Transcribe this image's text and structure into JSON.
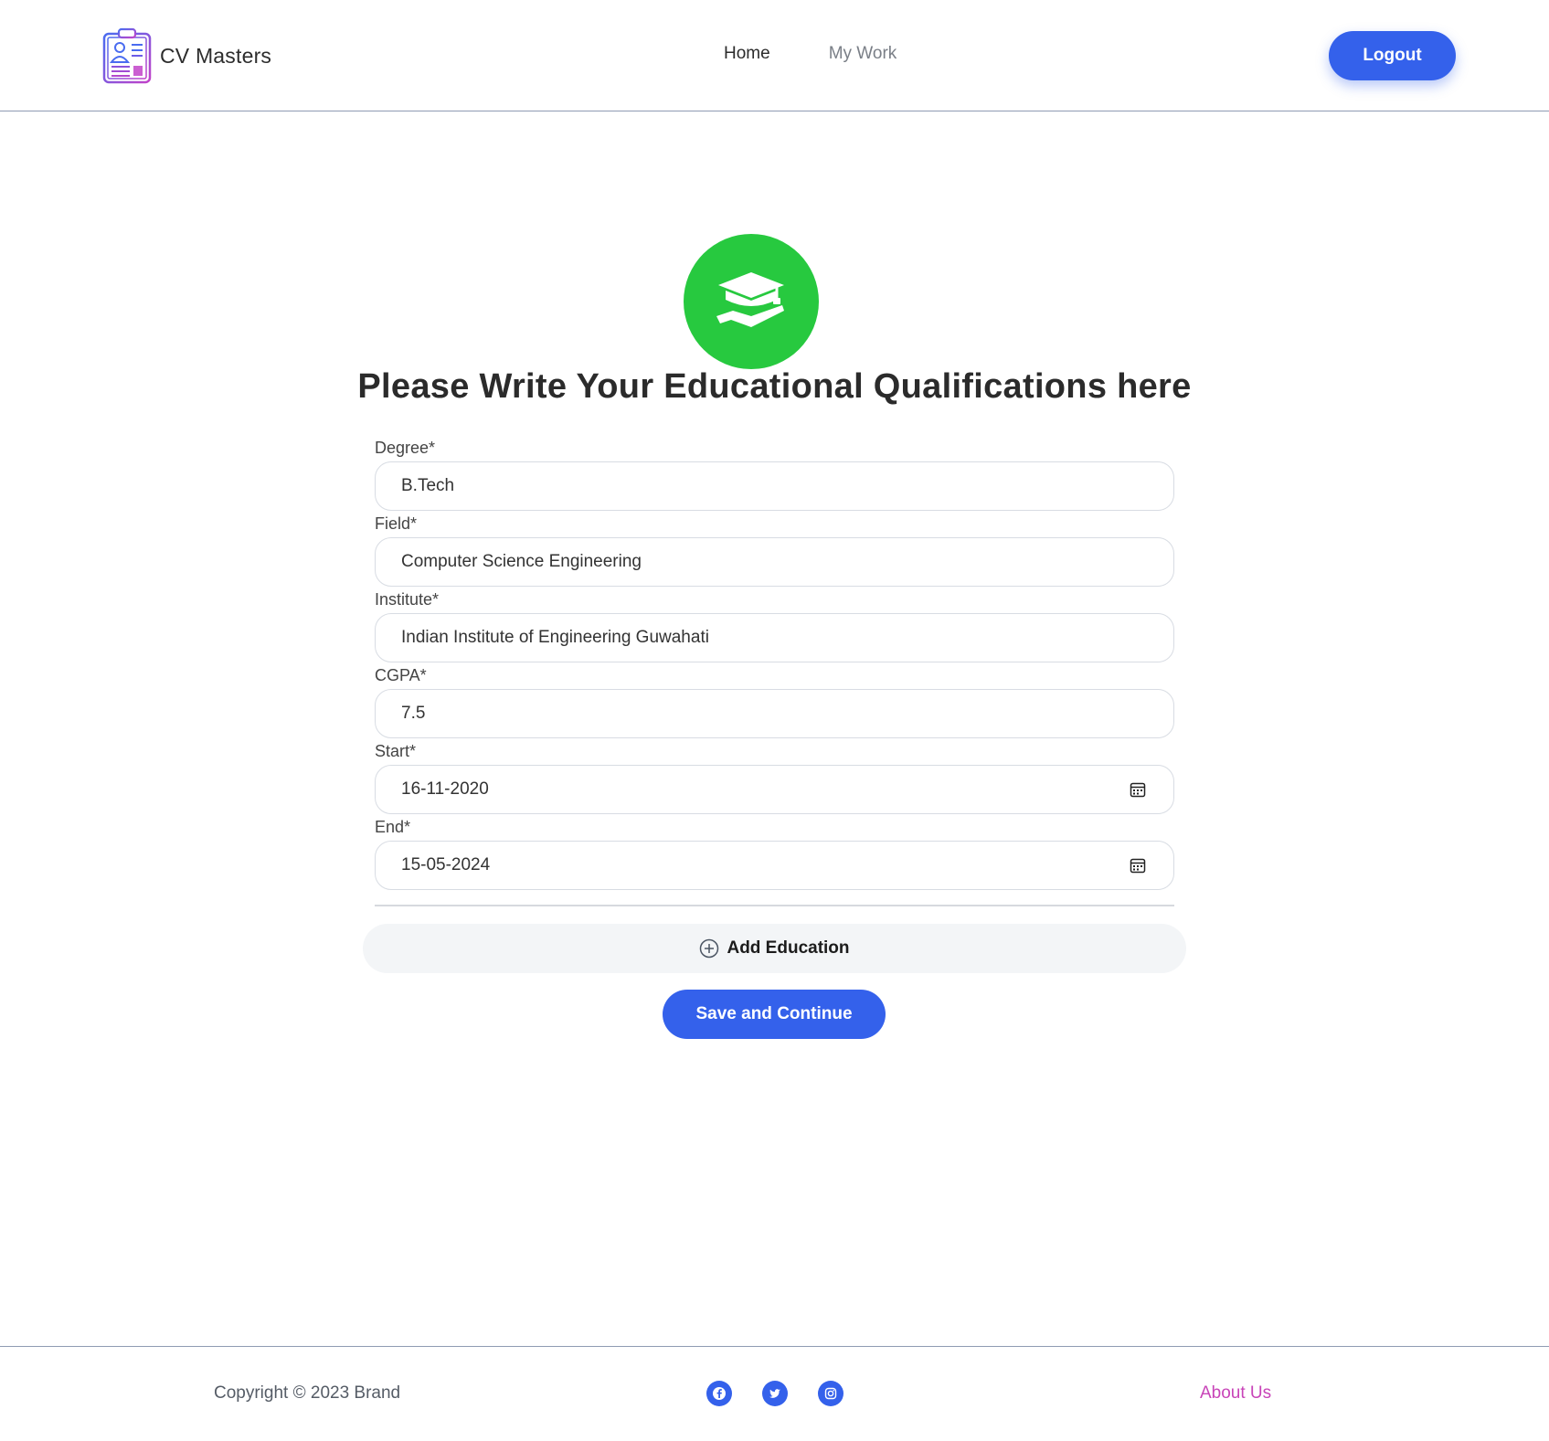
{
  "header": {
    "brand": "CV Masters",
    "nav": {
      "home": "Home",
      "my_work": "My Work"
    },
    "logout": "Logout"
  },
  "main": {
    "title": "Please Write Your Educational Qualifications here",
    "fields": {
      "degree": {
        "label": "Degree*",
        "value": "B.Tech"
      },
      "field": {
        "label": "Field*",
        "value": "Computer Science Engineering"
      },
      "institute": {
        "label": "Institute*",
        "value": "Indian Institute of Engineering Guwahati"
      },
      "cgpa": {
        "label": "CGPA*",
        "value": "7.5"
      },
      "start": {
        "label": "Start*",
        "value": "16-11-2020"
      },
      "end": {
        "label": "End*",
        "value": "15-05-2024"
      }
    },
    "add_education": "Add Education",
    "save_continue": "Save and Continue"
  },
  "footer": {
    "copyright": "Copyright © 2023 Brand",
    "about": "About Us",
    "socials": [
      "facebook-icon",
      "twitter-icon",
      "instagram-icon"
    ]
  },
  "colors": {
    "primary": "#3461eb",
    "hero": "#27c93f",
    "about_link": "#c844b8"
  }
}
